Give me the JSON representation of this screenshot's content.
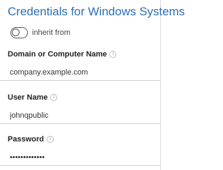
{
  "panel": {
    "title": "Credentials for Windows Systems",
    "inherit_toggle": {
      "label": "inherit from",
      "state": "off"
    },
    "fields": {
      "domain": {
        "label": "Domain or Computer Name",
        "value": "company.example.com"
      },
      "username": {
        "label": "User Name",
        "value": "johnqpublic"
      },
      "password": {
        "label": "Password",
        "value": "•••••••••••••"
      }
    },
    "info_icon_glyph": "i"
  },
  "colors": {
    "title": "#2b6fb3",
    "border": "#cfcfcf",
    "icon": "#bdbdbd"
  }
}
